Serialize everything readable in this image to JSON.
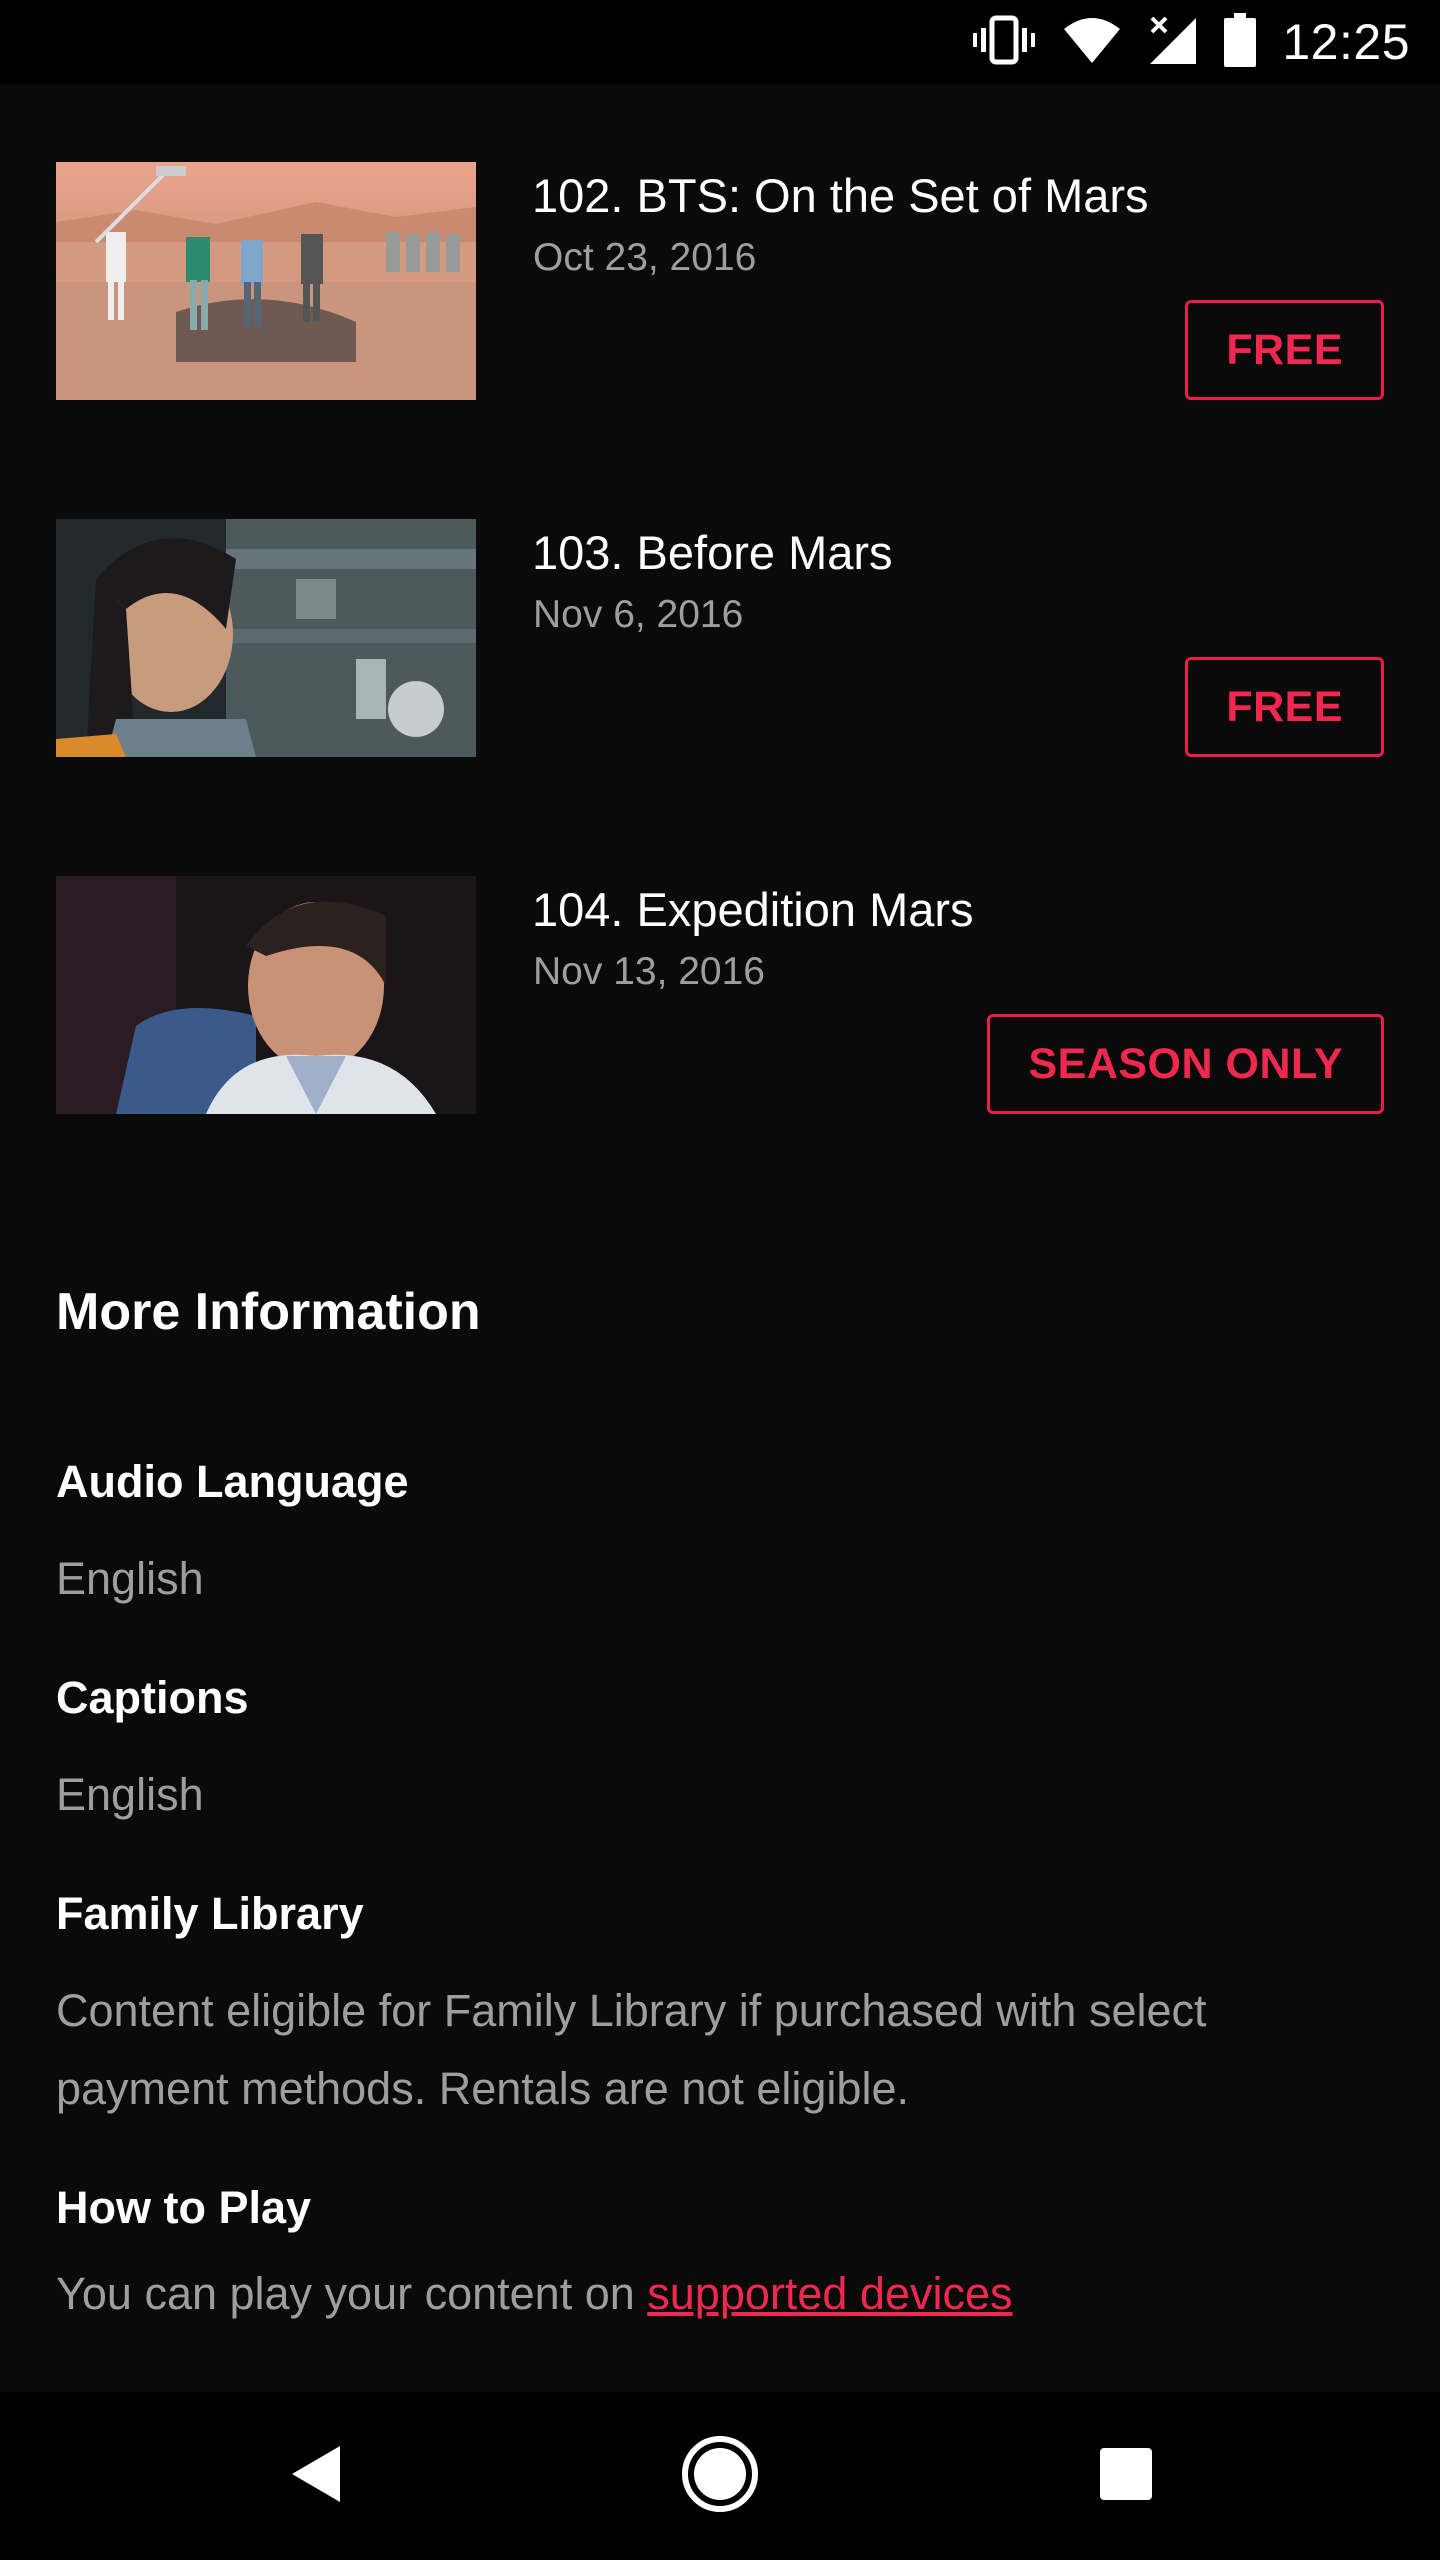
{
  "status_bar": {
    "time": "12:25",
    "icons": [
      "vibrate-icon",
      "wifi-icon",
      "signal-icon",
      "battery-icon"
    ]
  },
  "episodes": [
    {
      "title": "102. BTS: On the Set of Mars",
      "date": "Oct 23, 2016",
      "price_label": "FREE",
      "thumbnail": "behind-the-scenes-desert-crew"
    },
    {
      "title": "103. Before Mars",
      "date": "Nov 6, 2016",
      "price_label": "FREE",
      "thumbnail": "young-woman-in-lab"
    },
    {
      "title": "104. Expedition Mars",
      "date": "Nov 13, 2016",
      "price_label": "SEASON ONLY",
      "thumbnail": "man-interview"
    }
  ],
  "more_info": {
    "heading": "More Information",
    "audio_language": {
      "label": "Audio Language",
      "value": "English"
    },
    "captions": {
      "label": "Captions",
      "value": "English"
    },
    "family_library": {
      "label": "Family Library",
      "line1": "Content eligible for Family Library if purchased with select",
      "line2": "payment methods. Rentals are not eligible."
    },
    "how_to_play": {
      "label": "How to Play",
      "text": "You can play your content on ",
      "link_text": "supported devices"
    }
  },
  "nav_bar": {
    "buttons": [
      "back-icon",
      "home-icon",
      "recents-icon"
    ]
  },
  "colors": {
    "background": "#0a0a0a",
    "accent": "#f0284f",
    "secondary_text": "#9e9e9e"
  }
}
